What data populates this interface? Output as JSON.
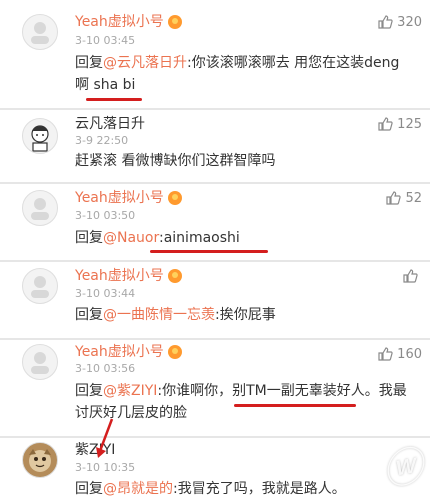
{
  "comments": [
    {
      "username": "Yeah虚拟小号",
      "timestamp": "3-10 03:45",
      "likes": "320",
      "reply_prefix": "回复",
      "mention": "@云凡落日升",
      "text": ":你该滚哪滚哪去 用您在这装deng啊 sha bi"
    },
    {
      "username": "云凡落日升",
      "timestamp": "3-9 22:50",
      "likes": "125",
      "text": "赶紧滚 看微博缺你们这群智障吗"
    },
    {
      "username": "Yeah虚拟小号",
      "timestamp": "3-10 03:50",
      "likes": "52",
      "reply_prefix": "回复",
      "mention": "@Nauor",
      "text": ":ainimaoshi"
    },
    {
      "username": "Yeah虚拟小号",
      "timestamp": "3-10 03:44",
      "likes": "",
      "reply_prefix": "回复",
      "mention": "@一曲陈情一忘羡",
      "text": ":挨你屁事"
    },
    {
      "username": "Yeah虚拟小号",
      "timestamp": "3-10 03:56",
      "likes": "160",
      "reply_prefix": "回复",
      "mention": "@紫ZIYI",
      "text": ":你谁啊你，别TM一副无辜装好人。我最讨厌好几层皮的脸"
    },
    {
      "username": "紫ZIYI",
      "timestamp": "3-10 10:35",
      "likes": "",
      "reply_prefix": "回复",
      "mention": "@昂就是的",
      "text": ":我冒充了吗，我就是路人。"
    }
  ],
  "colors": {
    "username": "#eb7350",
    "mention": "#eb7350",
    "annotation_red": "#d41e1e"
  },
  "icons": {
    "like": "thumbs-up-icon",
    "badge": "vip-badge-icon"
  }
}
